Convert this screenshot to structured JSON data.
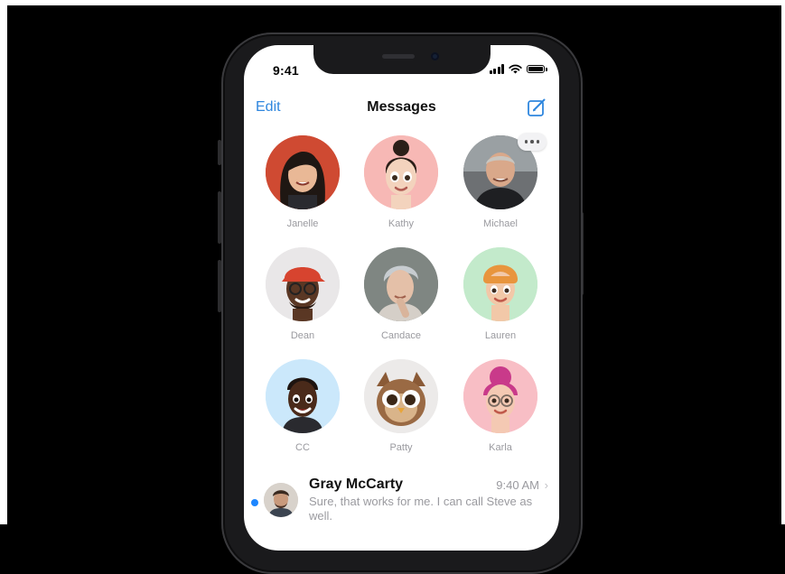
{
  "status_bar": {
    "time": "9:41"
  },
  "nav": {
    "edit_label": "Edit",
    "title": "Messages",
    "compose_icon": "compose-icon"
  },
  "pinned": [
    {
      "name": "Janelle",
      "kind": "photo"
    },
    {
      "name": "Kathy",
      "kind": "memoji"
    },
    {
      "name": "Michael",
      "kind": "photo",
      "has_more_badge": true
    },
    {
      "name": "Dean",
      "kind": "memoji"
    },
    {
      "name": "Candace",
      "kind": "photo"
    },
    {
      "name": "Lauren",
      "kind": "memoji"
    },
    {
      "name": "CC",
      "kind": "memoji"
    },
    {
      "name": "Patty",
      "kind": "memoji"
    },
    {
      "name": "Karla",
      "kind": "memoji"
    }
  ],
  "conversations": [
    {
      "name": "Gray McCarty",
      "time": "9:40 AM",
      "preview": "Sure, that works for me. I can call Steve as well.",
      "unread": true
    }
  ],
  "colors": {
    "accent": "#2e86de",
    "unread_dot": "#1d86ff",
    "label_gray": "#9a9a9f"
  }
}
